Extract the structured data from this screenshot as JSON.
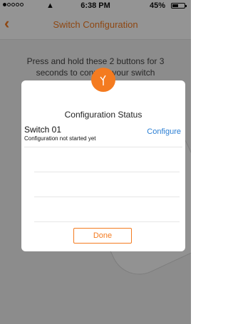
{
  "status_bar": {
    "time": "6:38 PM",
    "battery": "45%",
    "signal_icon": "signal-dots-icon",
    "wifi_icon": "wifi-icon",
    "battery_icon": "battery-icon"
  },
  "nav": {
    "title": "Switch Configuration",
    "back_icon": "chevron-left-icon"
  },
  "background": {
    "instruction": "Press and hold these 2 buttons for 3 seconds to connect your switch"
  },
  "modal": {
    "logo_icon": "leaf-logo-icon",
    "title": "Configuration Status",
    "switches": [
      {
        "name": "Switch 01",
        "status": "Configuration not started yet",
        "action": "Configure"
      }
    ],
    "done_label": "Done"
  },
  "colors": {
    "accent": "#f47b20",
    "link": "#2a7ed3",
    "overlay": "rgba(0,0,0,0.42)"
  }
}
